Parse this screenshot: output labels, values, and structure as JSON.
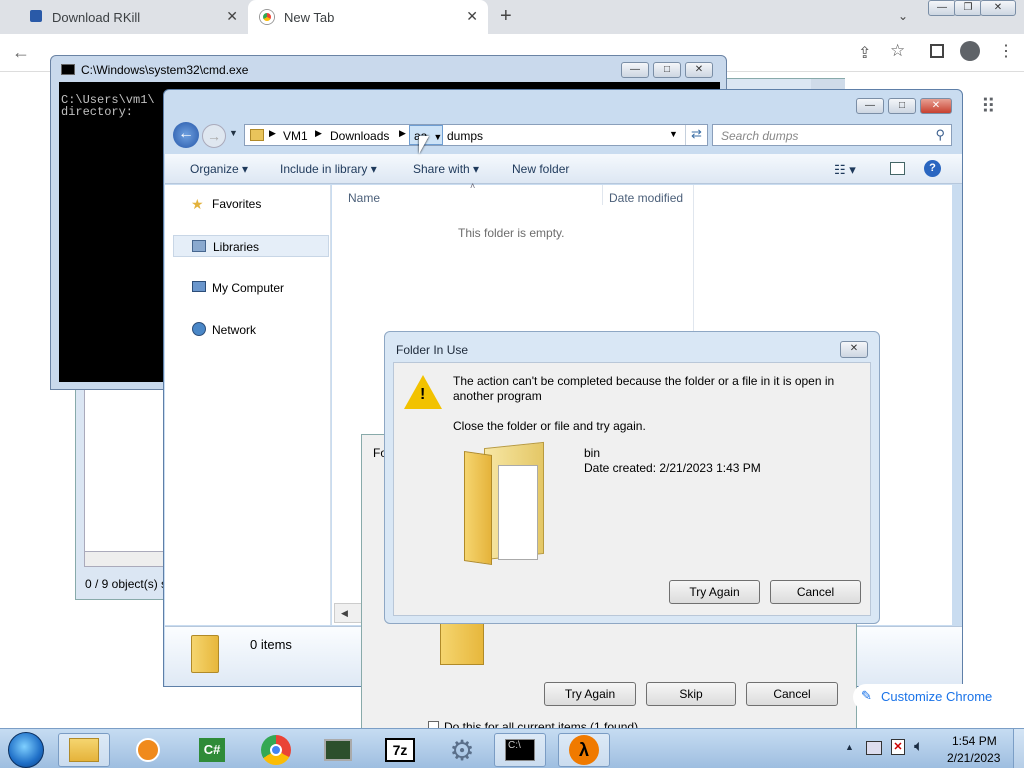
{
  "chrome": {
    "tabs": [
      {
        "label": "Download RKill",
        "active": false
      },
      {
        "label": "New Tab",
        "active": true
      }
    ],
    "new_tab_glyph": "+",
    "customize_label": "Customize Chrome"
  },
  "cmd": {
    "title": "C:\\Windows\\system32\\cmd.exe",
    "lines": [
      "C:\\Users\\vm1\\",
      "directory:"
    ]
  },
  "explorer": {
    "breadcrumb": [
      "VM1",
      "Downloads",
      "aa",
      "dumps"
    ],
    "search_placeholder": "Search dumps",
    "toolbar": {
      "organize": "Organize",
      "include": "Include in library",
      "share": "Share with",
      "new_folder": "New folder"
    },
    "nav": [
      {
        "label": "Favorites",
        "icon": "star-icon"
      },
      {
        "label": "Libraries",
        "icon": "library-icon"
      },
      {
        "label": "My Computer",
        "icon": "computer-icon"
      },
      {
        "label": "Network",
        "icon": "network-icon"
      }
    ],
    "columns": {
      "name": "Name",
      "date": "Date modified"
    },
    "empty_text": "This folder is empty.",
    "status_count": "0 items"
  },
  "behind_window": {
    "status": "0 / 9 object(s) s"
  },
  "back_dialog": {
    "title_fragment": "Fo",
    "try_again": "Try Again",
    "skip": "Skip",
    "cancel": "Cancel",
    "checkbox_text": "Do this for all current items (1 found)"
  },
  "dialog": {
    "title": "Folder In Use",
    "message": "The action can't be completed because the folder or a file in it is open in another program",
    "instruction": "Close the folder or file and try again.",
    "file_name": "bin",
    "date_created": "Date created: 2/21/2023 1:43 PM",
    "try_again": "Try Again",
    "cancel": "Cancel"
  },
  "taskbar": {
    "time": "1:54 PM",
    "date": "2/21/2023"
  },
  "colors": {
    "accent": "#1a73e8",
    "titlebar": "#c9dcf0",
    "close_red": "#c7402f"
  }
}
